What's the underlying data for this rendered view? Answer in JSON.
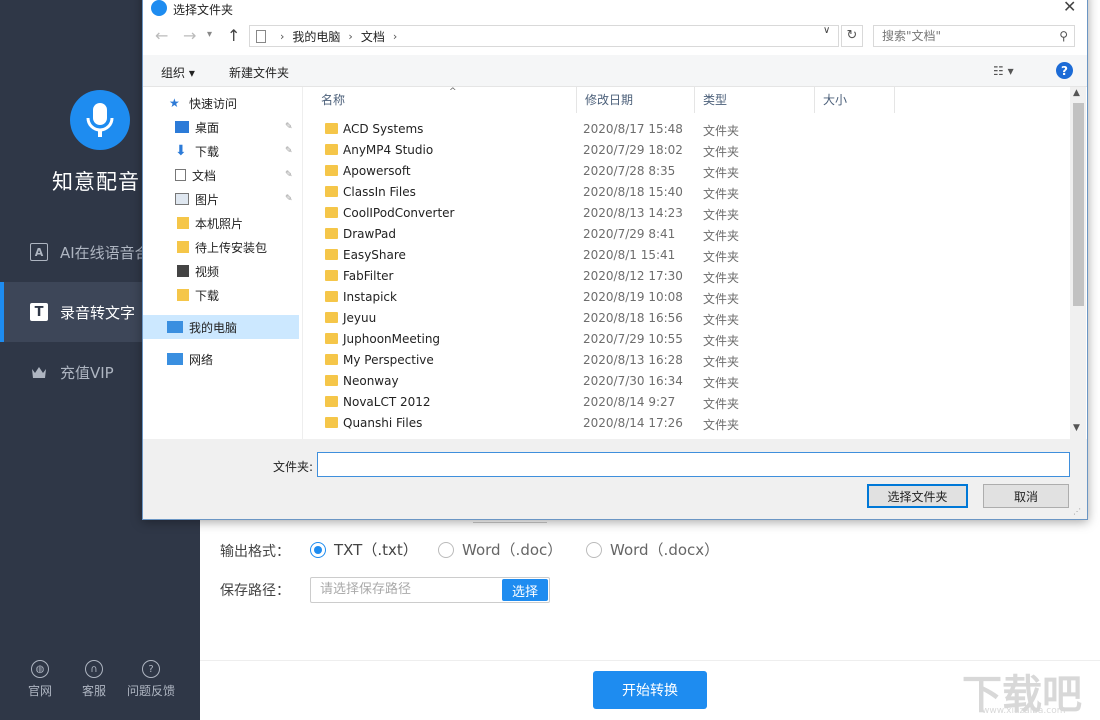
{
  "app": {
    "name": "知意配音",
    "nav": [
      {
        "label": "AI在线语音合",
        "icon": "ai-icon"
      },
      {
        "label": "录音转文字",
        "icon": "text-t-icon",
        "active": true
      },
      {
        "label": "充值VIP",
        "icon": "crown-icon"
      }
    ],
    "footer": [
      {
        "label": "官网",
        "icon": "globe-icon"
      },
      {
        "label": "客服",
        "icon": "headset-icon"
      },
      {
        "label": "问题反馈",
        "icon": "question-icon"
      }
    ],
    "accent_color": "#1e8cf0",
    "sidebar_color": "#2f3747"
  },
  "form": {
    "output_format_label": "输出格式：",
    "options": [
      "TXT（.txt）",
      "Word（.doc）",
      "Word（.docx）"
    ],
    "selected_option": "TXT（.txt）",
    "save_path_label": "保存路径：",
    "save_path_placeholder": "请选择保存路径",
    "choose_button": "选择",
    "start_button": "开始转换"
  },
  "dialog": {
    "title": "选择文件夹",
    "address": [
      "我的电脑",
      "文档"
    ],
    "search_placeholder": "搜索\"文档\"",
    "toolbar": {
      "organize": "组织 ▾",
      "new_folder": "新建文件夹"
    },
    "nav_pane": [
      {
        "label": "快速访问",
        "icon": "star-icon"
      },
      {
        "label": "桌面",
        "icon": "desktop-icon",
        "pinned": true
      },
      {
        "label": "下载",
        "icon": "download-icon",
        "pinned": true
      },
      {
        "label": "文档",
        "icon": "document-icon",
        "pinned": true
      },
      {
        "label": "图片",
        "icon": "picture-icon",
        "pinned": true
      },
      {
        "label": "本机照片",
        "icon": "folder-icon"
      },
      {
        "label": "待上传安装包",
        "icon": "folder-icon"
      },
      {
        "label": "视频",
        "icon": "video-icon"
      },
      {
        "label": "下载",
        "icon": "folder-icon"
      },
      {
        "label": "我的电脑",
        "icon": "computer-icon",
        "selected": true
      },
      {
        "label": "网络",
        "icon": "network-icon"
      }
    ],
    "columns": [
      "名称",
      "修改日期",
      "类型",
      "大小"
    ],
    "files": [
      {
        "name": "ACD Systems",
        "date": "2020/8/17 15:48",
        "type": "文件夹"
      },
      {
        "name": "AnyMP4 Studio",
        "date": "2020/7/29 18:02",
        "type": "文件夹"
      },
      {
        "name": "Apowersoft",
        "date": "2020/7/28 8:35",
        "type": "文件夹"
      },
      {
        "name": "ClassIn Files",
        "date": "2020/8/18 15:40",
        "type": "文件夹"
      },
      {
        "name": "CoolIPodConverter",
        "date": "2020/8/13 14:23",
        "type": "文件夹"
      },
      {
        "name": "DrawPad",
        "date": "2020/7/29 8:41",
        "type": "文件夹"
      },
      {
        "name": "EasyShare",
        "date": "2020/8/1 15:41",
        "type": "文件夹"
      },
      {
        "name": "FabFilter",
        "date": "2020/8/12 17:30",
        "type": "文件夹"
      },
      {
        "name": "Instapick",
        "date": "2020/8/19 10:08",
        "type": "文件夹"
      },
      {
        "name": "Jeyuu",
        "date": "2020/8/18 16:56",
        "type": "文件夹"
      },
      {
        "name": "JuphoonMeeting",
        "date": "2020/7/29 10:55",
        "type": "文件夹"
      },
      {
        "name": "My Perspective",
        "date": "2020/8/13 16:28",
        "type": "文件夹"
      },
      {
        "name": "Neonway",
        "date": "2020/7/30 16:34",
        "type": "文件夹"
      },
      {
        "name": "NovaLCT 2012",
        "date": "2020/8/14 9:27",
        "type": "文件夹"
      },
      {
        "name": "Quanshi Files",
        "date": "2020/8/14 17:26",
        "type": "文件夹"
      }
    ],
    "folder_label": "文件夹:",
    "folder_value": "",
    "select_button": "选择文件夹",
    "cancel_button": "取消"
  },
  "watermark": {
    "text": "下载吧",
    "sub": "www.xiazaiba.com"
  }
}
